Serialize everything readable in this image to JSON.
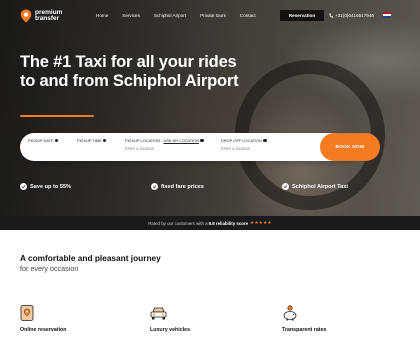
{
  "brand": {
    "logo_text": "premium transfer",
    "accent": "#f47b20"
  },
  "nav": {
    "links": [
      "Home",
      "Services",
      "Schiphol Airport",
      "Private tours",
      "Contact"
    ],
    "reservation_label": "Reservation",
    "phone": "+31(0)6416517946",
    "language_flag": "dutch-flag-icon"
  },
  "hero": {
    "title": "The #1 Taxi for all your rides to and from Schiphol Airport"
  },
  "search": {
    "pickup_date_label": "PICKUP DATE",
    "pickup_time_label": "PICKUP TIME",
    "pickup_location_label": "PICKUP LOCATION - ",
    "use_my_location": "USE MY LOCATION",
    "pickup_location_placeholder": "Enter a location",
    "dropoff_location_label": "DROP-OFF LOCATION",
    "dropoff_location_placeholder": "Enter a location",
    "book_label": "BOOK NOW"
  },
  "features": [
    "Save up to 55%",
    "fixed fare prices",
    "Schiphol Airport Taxi"
  ],
  "rating": {
    "prefix": "Rated by our customers with a",
    "score": "9.8 reliability score",
    "stars": "★★★★★"
  },
  "section": {
    "title": "A comfortable and pleasant journey",
    "subtitle": "for every occasion"
  },
  "cards": [
    {
      "label": "Online reservation",
      "icon": "phone-location-icon"
    },
    {
      "label": "Luxury vehicles",
      "icon": "car-icon"
    },
    {
      "label": "Transparent rates",
      "icon": "piggy-bank-icon"
    }
  ]
}
